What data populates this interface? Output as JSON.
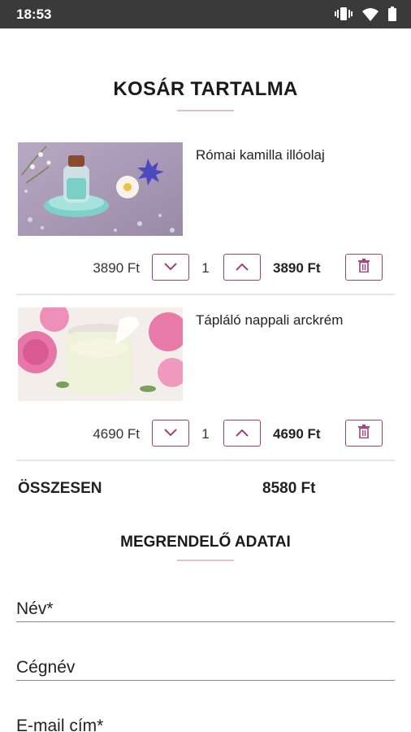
{
  "statusbar": {
    "time": "18:53"
  },
  "cart": {
    "title": "KOSÁR TARTALMA",
    "items": [
      {
        "name": "Római kamilla illóolaj",
        "price": "3890 Ft",
        "quantity": "1",
        "total": "3890 Ft"
      },
      {
        "name": "Tápláló nappali arckrém",
        "price": "4690 Ft",
        "quantity": "1",
        "total": "4690 Ft"
      }
    ],
    "summary": {
      "label": "ÖSSZESEN",
      "value": "8580 Ft"
    }
  },
  "orderer": {
    "title": "MEGRENDELŐ ADATAI",
    "fields": [
      {
        "placeholder": "Név*"
      },
      {
        "placeholder": "Cégnév"
      },
      {
        "placeholder": "E-mail cím*"
      }
    ]
  },
  "colors": {
    "accent": "#a0407a",
    "divider": "#d8c3cf"
  }
}
